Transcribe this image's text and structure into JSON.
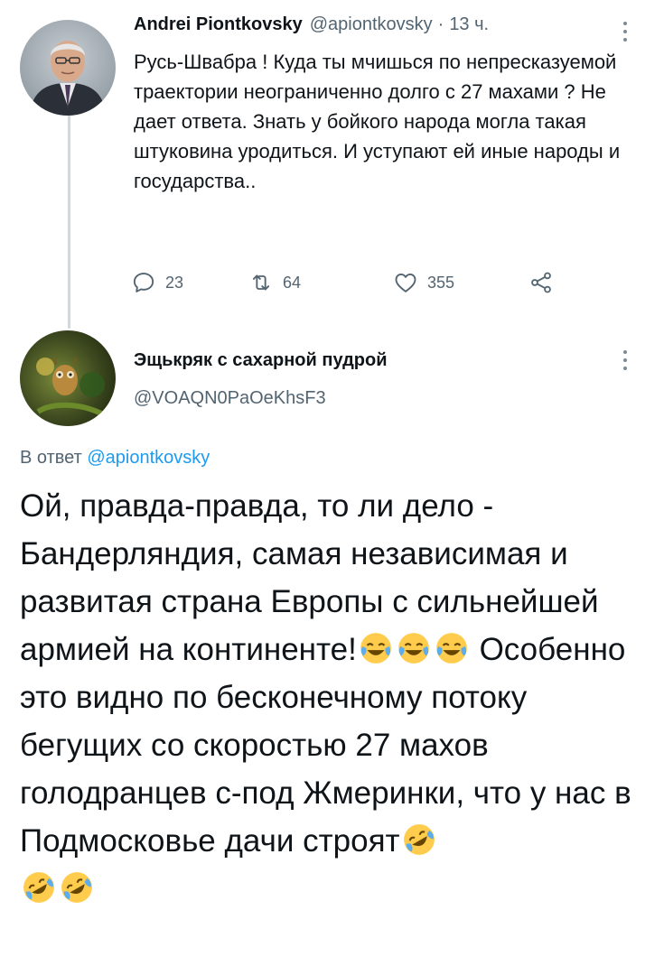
{
  "tweet1": {
    "author_name": "Andrei Piontkovsky",
    "author_handle": "@apiontkovsky",
    "separator": "·",
    "time": "13 ч.",
    "text": "Русь-Швабра ! Куда ты мчишься по непресказуемой траектории неограниченно долго с 27 махами ? Не дает ответа. Знать у бойкого народа могла такая штуковина уродиться. И уступают ей иные народы и государства..",
    "replies": "23",
    "retweets": "64",
    "likes": "355"
  },
  "tweet2": {
    "author_name": "Эщькряк с сахарной пудрой",
    "author_handle": "@VOAQN0PaOeKhsF3",
    "reply_prefix": "В ответ",
    "reply_handle": "@apiontkovsky",
    "text_part1": "Ой, правда-правда, то ли дело - Бандерляндия, самая независимая и развитая страна Европы с сильнейшей армией на континенте!",
    "text_part2": " Особенно это видно по бесконечному потоку бегущих со скоростью 27 махов голодранцев с-под Жмеринки, что у нас в Подмосковье дачи строят"
  },
  "icons": {
    "reply": "reply-icon",
    "retweet": "retweet-icon",
    "like": "heart-icon",
    "share": "share-icon",
    "more": "more-vertical-icon",
    "emoji_crying_laughing": "face-with-tears-of-joy-icon",
    "emoji_rofl": "rolling-on-floor-laughing-icon"
  },
  "colors": {
    "text_primary": "#0f1419",
    "text_secondary": "#536471",
    "link": "#1d9bf0",
    "thread_line": "#cfd9de"
  }
}
